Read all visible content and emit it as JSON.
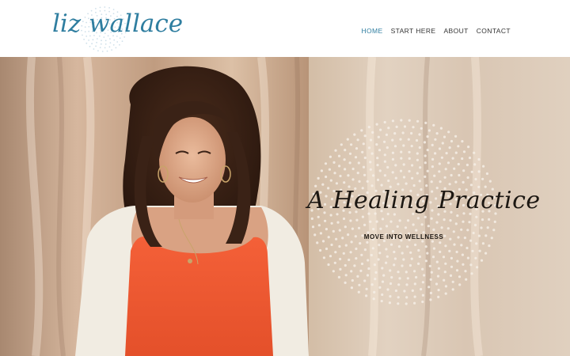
{
  "brand": {
    "logo_text": "liz wallace"
  },
  "nav": {
    "items": [
      {
        "label": "HOME",
        "active": true
      },
      {
        "label": "START HERE",
        "active": false
      },
      {
        "label": "ABOUT",
        "active": false
      },
      {
        "label": "CONTACT",
        "active": false
      }
    ]
  },
  "hero": {
    "headline": "A Healing Practice",
    "subheadline": "MOVE INTO WELLNESS"
  },
  "colors": {
    "accent": "#2f7ea0",
    "nav_text": "#333333",
    "headline_text": "#1c1712",
    "shirt": "#f0582f"
  }
}
